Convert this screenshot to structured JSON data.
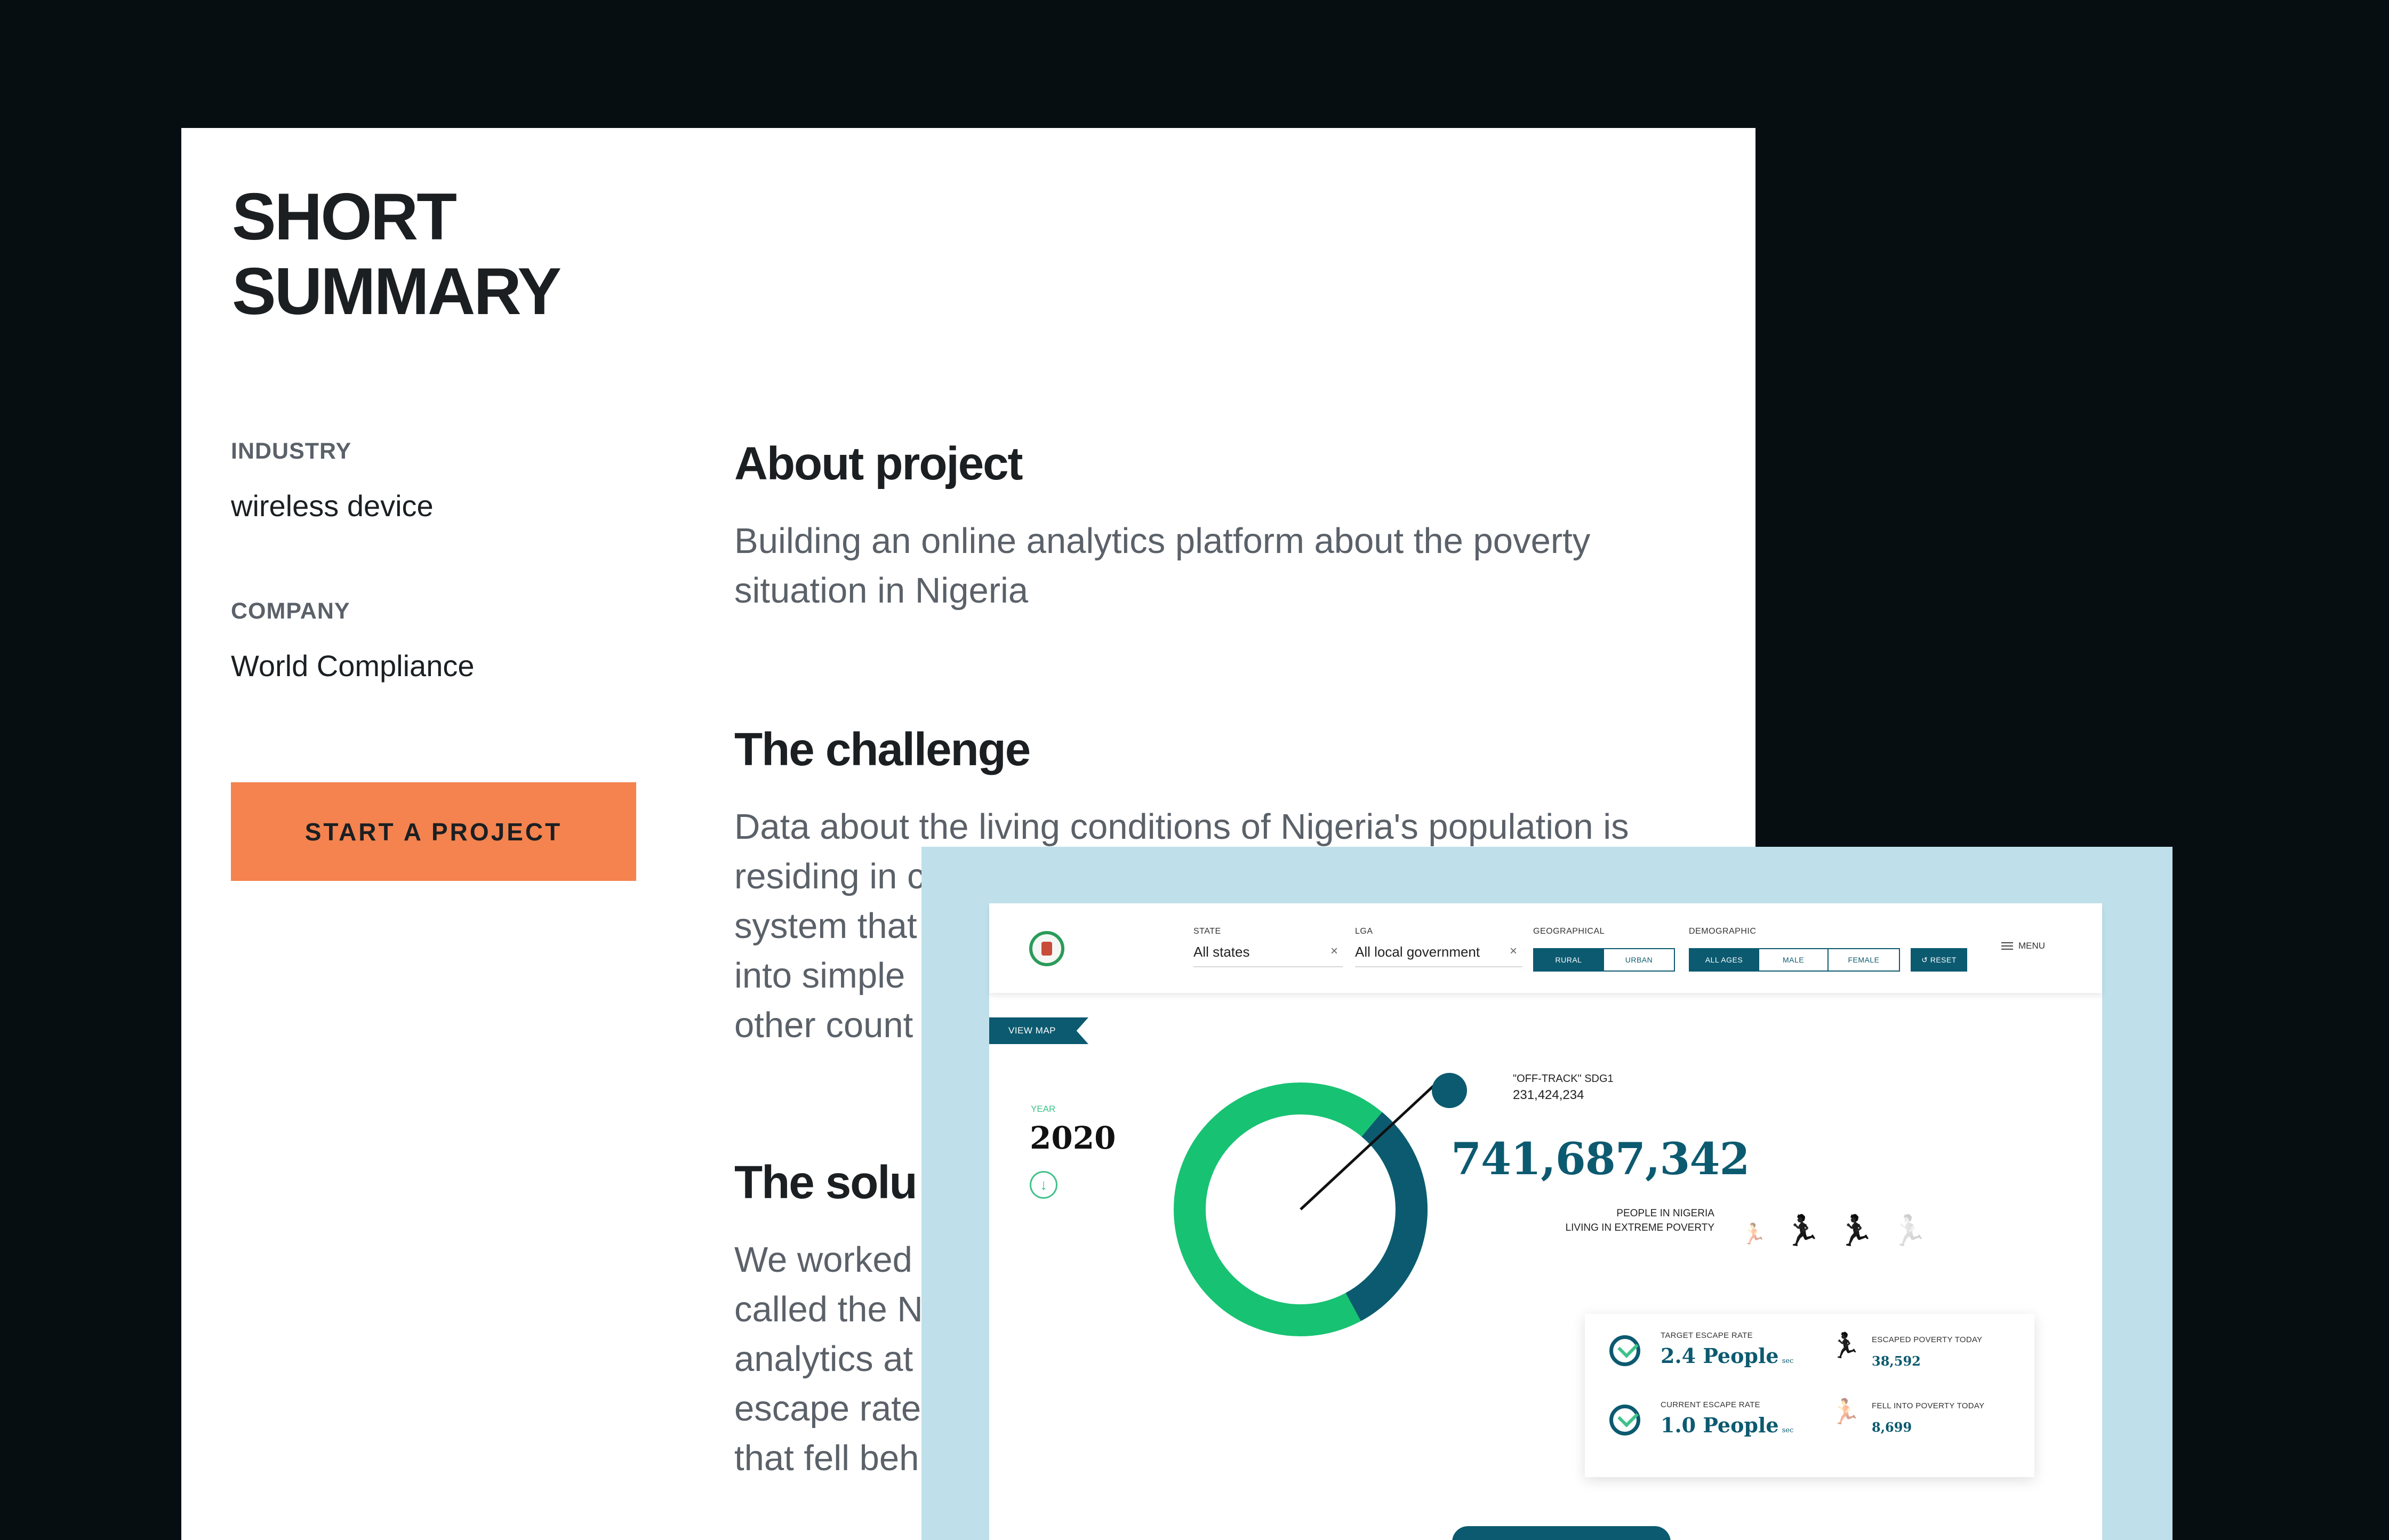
{
  "summary": {
    "title_line1": "SHORT",
    "title_line2": "SUMMARY",
    "industry_label": "INDUSTRY",
    "industry_value": "wireless device",
    "company_label": "COMPANY",
    "company_value": "World Compliance",
    "cta_label": "START A PROJECT"
  },
  "sections": {
    "about_title": "About project",
    "about_text": "Building an online analytics platform about the poverty situation in Nigeria",
    "challenge_title": "The challenge",
    "challenge_lines": [
      "Data about the living conditions of Nigeria's population is",
      "residing in c",
      "system that",
      "into simple",
      "other count"
    ],
    "solution_title": "The solu",
    "solution_lines": [
      "We worked",
      "called the N",
      "analytics at",
      "escape rate",
      "that fell beh"
    ]
  },
  "dashboard": {
    "filters": {
      "state_label": "STATE",
      "state_value": "All states",
      "lga_label": "LGA",
      "lga_value": "All local government",
      "geo_label": "GEOGRAPHICAL",
      "geo_options": [
        "RURAL",
        "URBAN"
      ],
      "demo_label": "DEMOGRAPHIC",
      "demo_options": [
        "ALL AGES",
        "MALE",
        "FEMALE"
      ],
      "reset_label": "↺ RESET",
      "clear_symbol": "×",
      "menu_label": "MENU"
    },
    "view_map_label": "VIEW MAP",
    "year_label": "YEAR",
    "year_value": "2020",
    "year_arrow": "↓",
    "off_track_label": "\"OFF-TRACK\" SDG1",
    "off_track_value": "231,424,234",
    "headline_value": "741,687,342",
    "headline_caption_1": "PEOPLE IN NIGERIA",
    "headline_caption_2": "LIVING IN EXTREME POVERTY",
    "donut_share_offtrack": 0.31,
    "colors": {
      "green": "#18c273",
      "teal": "#0c5a70",
      "orange_cta": "#f4834f",
      "overlay_bg": "#bfe0ea"
    },
    "stats": {
      "target_label": "TARGET ESCAPE RATE",
      "target_value": "2.4 People",
      "target_unit": "sec",
      "current_label": "CURRENT ESCAPE RATE",
      "current_value": "1.0 People",
      "current_unit": "sec",
      "escaped_label": "ESCAPED POVERTY TODAY",
      "escaped_value": "38,592",
      "fell_label": "FELL INTO POVERTY TODAY",
      "fell_value": "8,699"
    },
    "runner_glyph": "🏃"
  }
}
